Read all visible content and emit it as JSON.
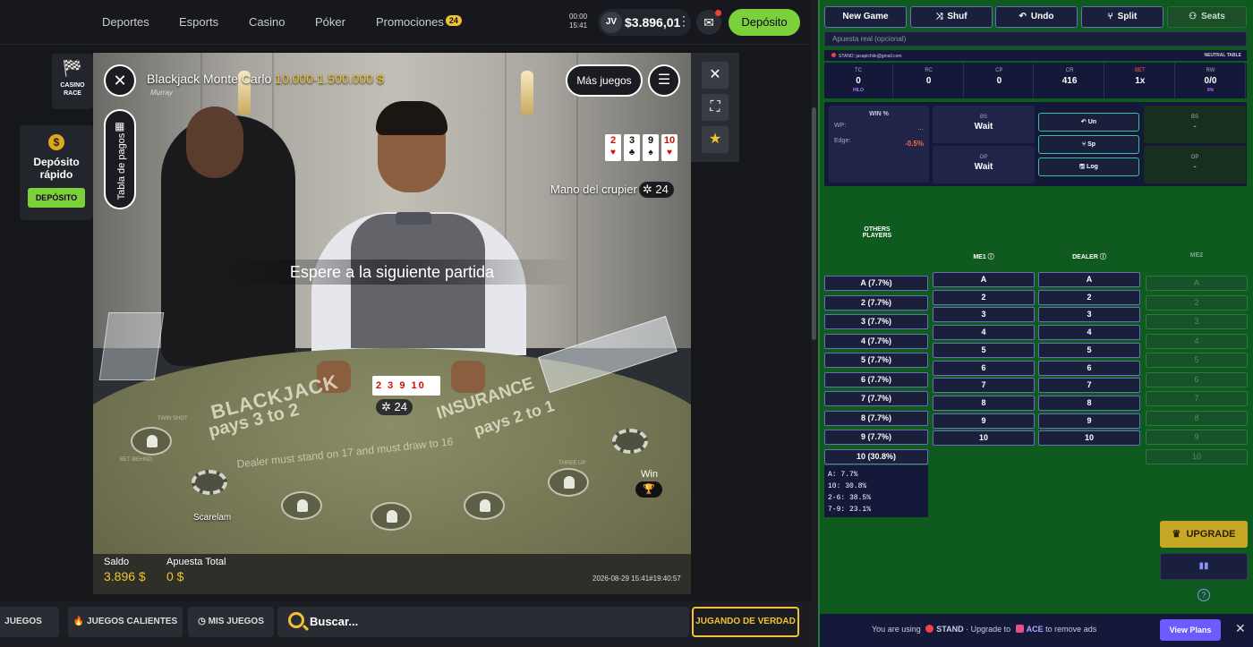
{
  "nav": {
    "items": [
      "Deportes",
      "Esports",
      "Casino",
      "Póker",
      "Promociones"
    ],
    "promo_badge": "24",
    "clock_time": "00:00",
    "clock_sub": "15:41",
    "avatar": "JV",
    "balance": "$3.896,01",
    "kebab": "⋮",
    "deposit": "Depósito"
  },
  "left": {
    "race": "CASINO RACE",
    "quick_deposit": "Depósito rápido",
    "quick_deposit_btn": "DEPÓSITO",
    "coin": "$"
  },
  "game": {
    "title": "Blackjack Monte Carlo",
    "limits": "10.000-1.500.000 $",
    "dealer_name": "Murray",
    "paytable": "Tabla de pagos",
    "more_games": "Más juegos",
    "dealer_cards": [
      {
        "r": "2",
        "s": "♥",
        "red": true
      },
      {
        "r": "3",
        "s": "♣",
        "red": false
      },
      {
        "r": "9",
        "s": "♠",
        "red": false
      },
      {
        "r": "10",
        "s": "♥",
        "red": true
      }
    ],
    "dealer_hand_label": "Mano del crupier",
    "dealer_score": "24",
    "waiting": "Espere a la siguiente partida",
    "table_cards": "2 3 9 10",
    "table_score": "24",
    "table_text1": "BLACKJACK",
    "table_text2": "pays 3 to 2",
    "table_text3": "INSURANCE",
    "table_text4": "pays 2 to 1",
    "table_text5": "Dealer must stand on 17 and must draw to 16",
    "seat_labels": [
      "TWIN SHOT",
      "BET BEHIND",
      "THREE UP"
    ],
    "seat_player": "Scarelam",
    "win": "Win",
    "saldo_label": "Saldo",
    "saldo_value": "3.896 $",
    "apuesta_label": "Apuesta Total",
    "apuesta_value": "0 $",
    "timestamp": "2026-08-29 15:41#19:40:57"
  },
  "bottom": {
    "new_games": "JUEGOS NUEVOS",
    "hot": "JUEGOS CALIENTES",
    "my_games": "MIS JUEGOS",
    "search": "Buscar...",
    "real": "JUGANDO DE VERDAD"
  },
  "panel": {
    "buttons": [
      {
        "label": "New Game",
        "icon": ""
      },
      {
        "label": "Shuf",
        "icon": "⤨"
      },
      {
        "label": "Undo",
        "icon": "↶"
      },
      {
        "label": "Split",
        "icon": "⑂"
      },
      {
        "label": "Seats",
        "icon": "⚇"
      }
    ],
    "apuesta_placeholder": "Apuesta real (opcional)",
    "status": "STAND: jaxapichile@gmail.com",
    "neutral": "NEUTRAL TABLE",
    "stats": [
      {
        "l": "TC",
        "v": "0",
        "x": "HILO"
      },
      {
        "l": "RC",
        "v": "0",
        "x": ""
      },
      {
        "l": "CP",
        "v": "0",
        "x": ""
      },
      {
        "l": "CR",
        "v": "416",
        "x": ""
      },
      {
        "l": "BET",
        "v": "1x",
        "x": ""
      },
      {
        "l": "RW",
        "v": "0/0",
        "x": "0%"
      }
    ],
    "winpct": "WIN %",
    "wp_label": "WP:",
    "wp_value": "...",
    "edge_label": "Edge:",
    "edge_value": "-0.5%",
    "bs_label": "BS",
    "bs_value": "Wait",
    "op_label": "OP",
    "op_value": "Wait",
    "side_btns": [
      "Un",
      "Sp",
      "Log"
    ],
    "bs2_label": "BS",
    "bs2_value": "-",
    "op2_label": "OP",
    "op2_value": "-",
    "others": "OTHERS PLAYERS",
    "me1": "ME1",
    "dealer": "DEALER",
    "me2": "ME2",
    "others_cells": [
      "A  (7.7%)",
      "2  (7.7%)",
      "3  (7.7%)",
      "4  (7.7%)",
      "5  (7.7%)",
      "6  (7.7%)",
      "7  (7.7%)",
      "8  (7.7%)",
      "9  (7.7%)",
      "10  (30.8%)"
    ],
    "ranks": [
      "A",
      "2",
      "3",
      "4",
      "5",
      "6",
      "7",
      "8",
      "9",
      "10"
    ],
    "dist": [
      "A: 7.7%",
      "10: 30.8%",
      "2-6: 38.5%",
      "7-9: 23.1%"
    ],
    "upgrade": "UPGRADE",
    "ad_prefix": "You are using",
    "ad_stand": "STAND",
    "ad_mid": "· Upgrade to",
    "ad_ace": "ACE",
    "ad_suffix": "to remove ads",
    "view_plans": "View Plans"
  }
}
